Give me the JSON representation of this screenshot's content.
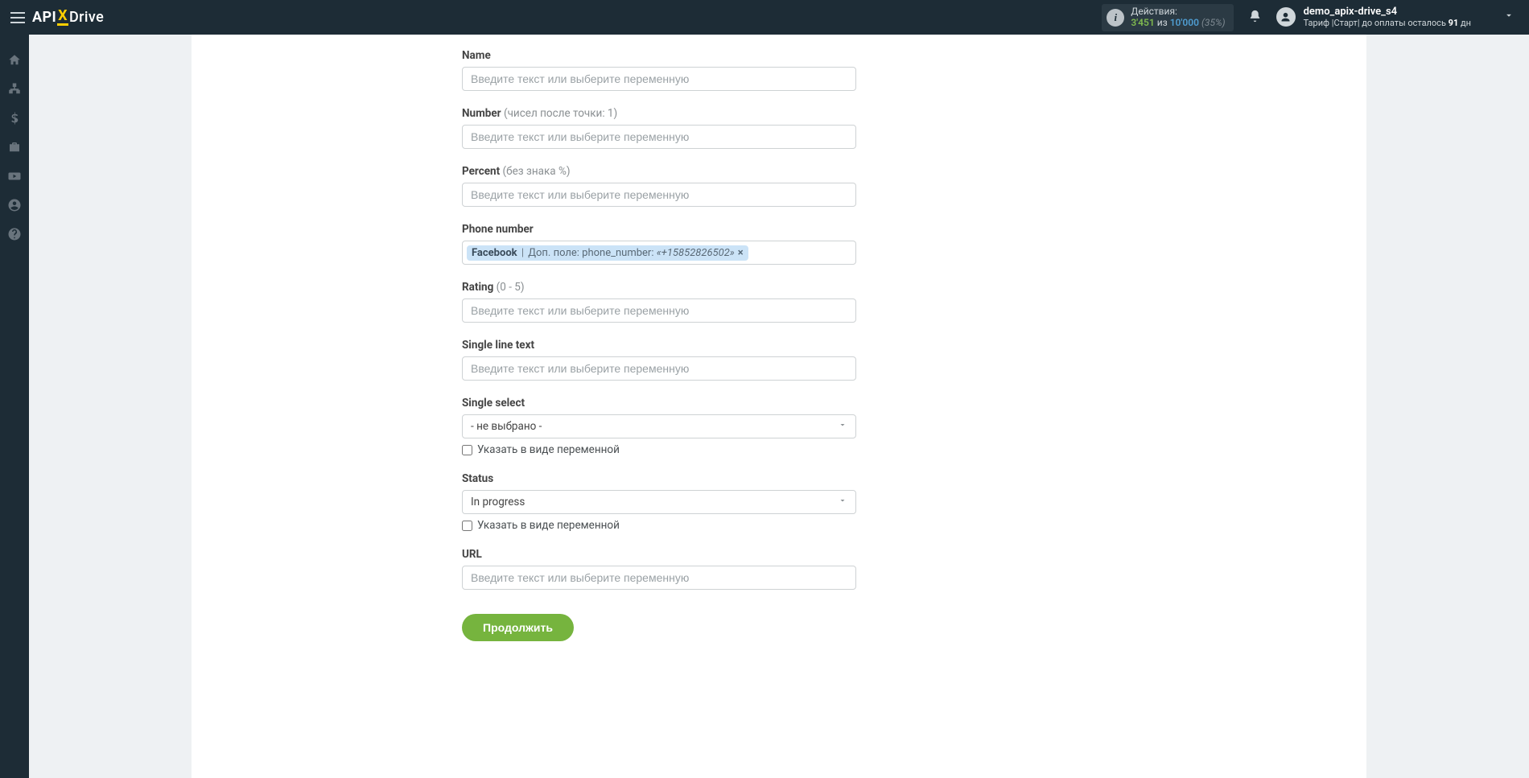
{
  "header": {
    "logo": {
      "api": "API",
      "x": "X",
      "drive": "Drive"
    },
    "actions": {
      "label": "Действия:",
      "used": "3'451",
      "of_word": "из",
      "limit": "10'000",
      "pct": "(35%)"
    },
    "user": {
      "name": "demo_apix-drive_s4",
      "tariff_prefix": "Тариф |Старт| до оплаты осталось",
      "days": "91",
      "days_suffix": "дн"
    }
  },
  "sidebar_items": [
    {
      "name": "home"
    },
    {
      "name": "integrations"
    },
    {
      "name": "billing"
    },
    {
      "name": "tools"
    },
    {
      "name": "video"
    },
    {
      "name": "account"
    },
    {
      "name": "help"
    }
  ],
  "form": {
    "placeholder": "Введите текст или выберите переменную",
    "fields": {
      "name": {
        "label": "Name"
      },
      "number": {
        "label": "Number",
        "hint": "(чисел после точки: 1)"
      },
      "percent": {
        "label": "Percent",
        "hint": "(без знака %)"
      },
      "phone": {
        "label": "Phone number",
        "tag": {
          "source": "Facebook",
          "sep": "|",
          "desc": "Доп. поле: phone_number:",
          "value": "«+15852826502»"
        }
      },
      "rating": {
        "label": "Rating",
        "hint": "(0 - 5)"
      },
      "single_line": {
        "label": "Single line text"
      },
      "single_select": {
        "label": "Single select",
        "value": "- не выбрано -",
        "variable_chk": "Указать в виде переменной"
      },
      "status": {
        "label": "Status",
        "value": "In progress",
        "variable_chk": "Указать в виде переменной"
      },
      "url": {
        "label": "URL"
      }
    },
    "cta": "Продолжить"
  }
}
